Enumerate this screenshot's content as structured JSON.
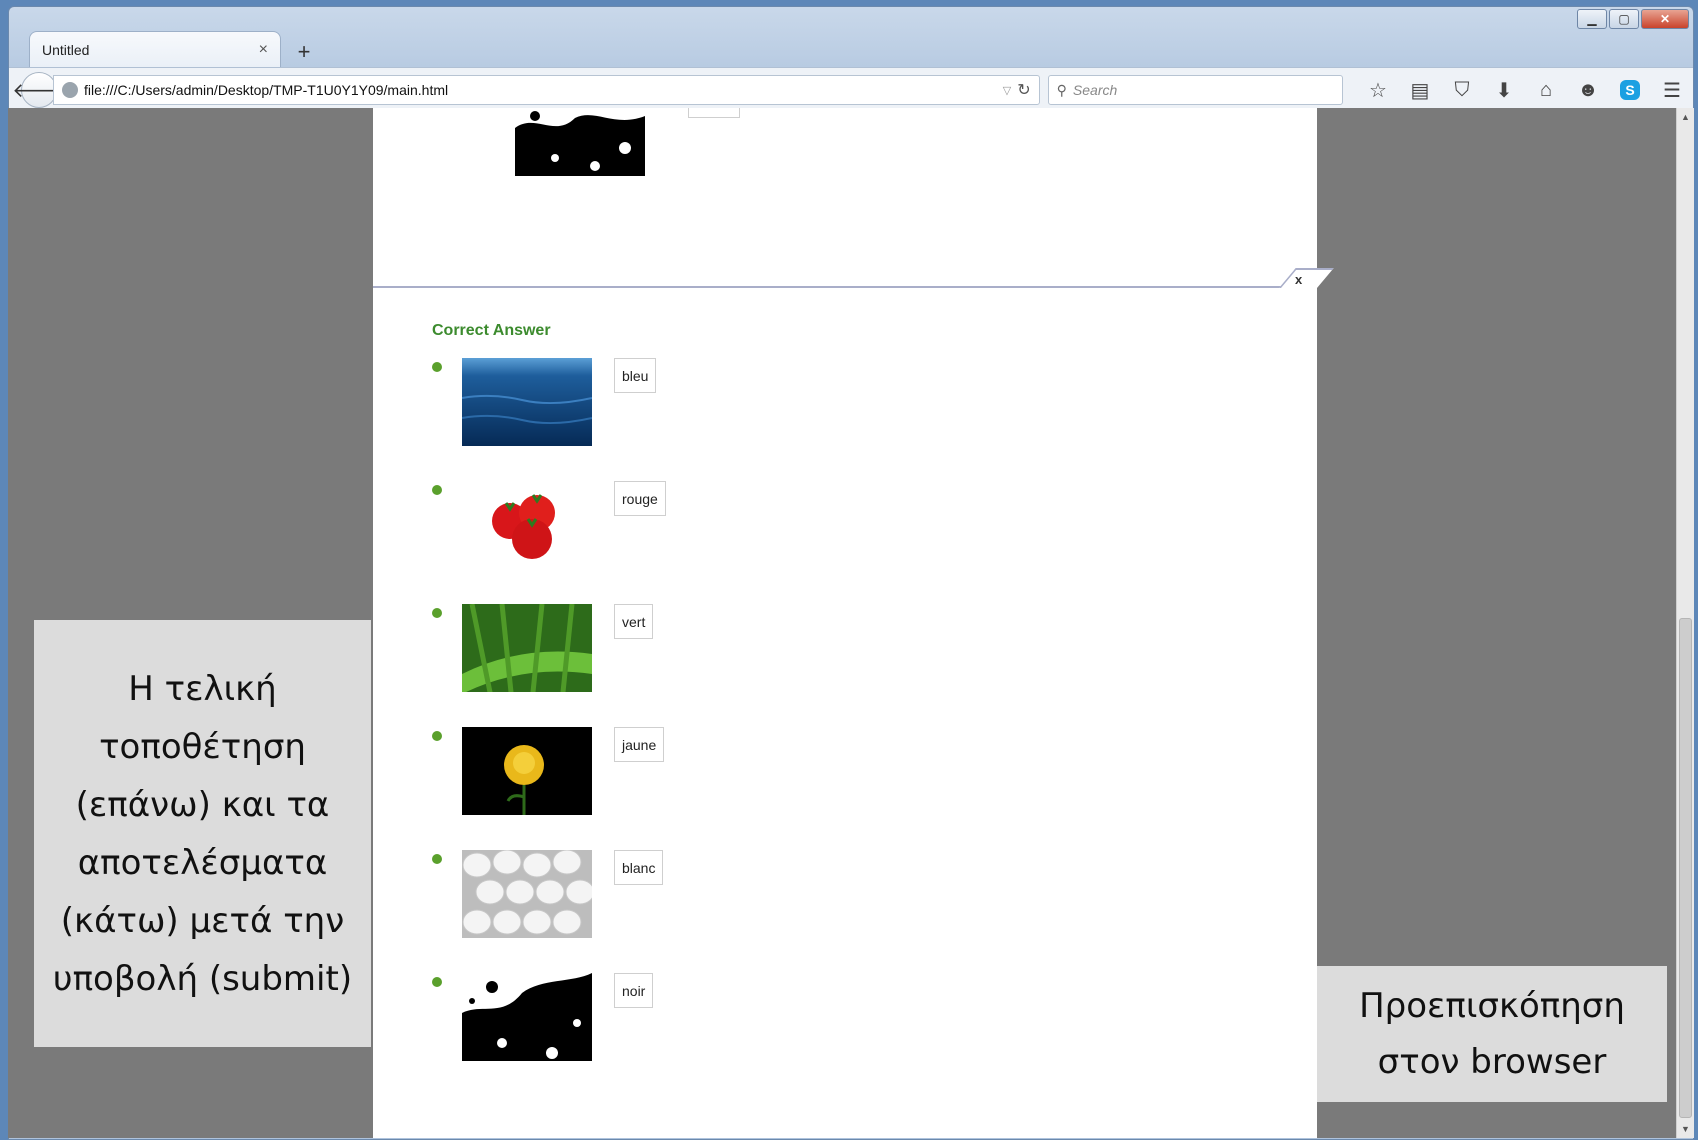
{
  "browser": {
    "tab_title": "Untitled",
    "tab_close": "×",
    "new_tab": "+",
    "url": "file:///C:/Users/admin/Desktop/TMP-T1U0Y1Y09/main.html",
    "search_placeholder": "Search",
    "window_controls": [
      "minimize-icon",
      "maximize-icon",
      "close-icon"
    ],
    "toolbar_icons": [
      "star-icon",
      "reading-list-icon",
      "pocket-icon",
      "download-icon",
      "home-icon",
      "chat-icon",
      "skype-icon",
      "menu-icon"
    ]
  },
  "result": {
    "close_label": "x",
    "title": "Correct Answer",
    "title_color": "#3c8b2e",
    "bullet_color": "#5aa02c",
    "items": [
      {
        "answer": "bleu",
        "image": "sea-image"
      },
      {
        "answer": "rouge",
        "image": "tomatoes-image"
      },
      {
        "answer": "vert",
        "image": "grass-image"
      },
      {
        "answer": "jaune",
        "image": "yellow-rose-image"
      },
      {
        "answer": "blanc",
        "image": "eggs-image"
      },
      {
        "answer": "noir",
        "image": "black-splash-image"
      }
    ]
  },
  "callouts": {
    "left": "Η τελική τοποθέτηση (επάνω) και τα αποτελέσματα (κάτω) μετά την υποβολή (submit)",
    "right": "Προεπισκόπηση στον browser"
  }
}
